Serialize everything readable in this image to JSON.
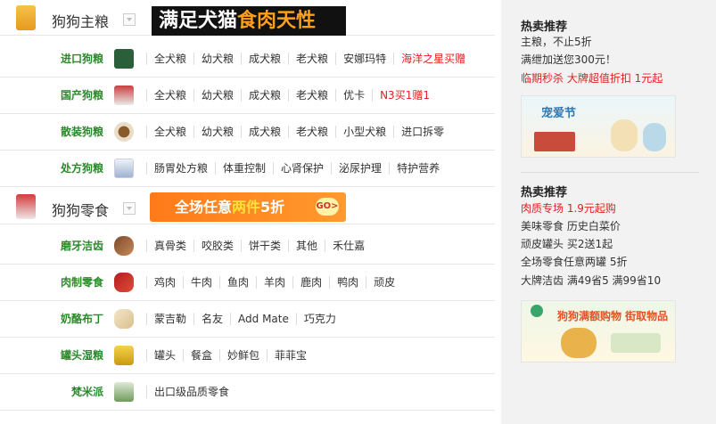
{
  "sections": [
    {
      "title": "狗狗主粮",
      "banner": {
        "white": "满足犬猫",
        "orange": "食肉天性"
      },
      "rows": [
        {
          "category": "进口狗粮",
          "links": [
            "全犬粮",
            "幼犬粮",
            "成犬粮",
            "老犬粮",
            "安娜玛特"
          ],
          "hot": "海洋之星买赠"
        },
        {
          "category": "国产狗粮",
          "links": [
            "全犬粮",
            "幼犬粮",
            "成犬粮",
            "老犬粮",
            "优卡"
          ],
          "hot": "N3买1赠1"
        },
        {
          "category": "散装狗粮",
          "links": [
            "全犬粮",
            "幼犬粮",
            "成犬粮",
            "老犬粮",
            "小型犬粮",
            "进口拆零"
          ],
          "hot": ""
        },
        {
          "category": "处方狗粮",
          "links": [
            "肠胃处方粮",
            "体重控制",
            "心肾保护",
            "泌尿护理",
            "特护营养"
          ],
          "hot": ""
        }
      ]
    },
    {
      "title": "狗狗零食",
      "banner": {
        "white": "全场任意",
        "yellow": "两件",
        "white2": "5折",
        "go": "GO>"
      },
      "rows": [
        {
          "category": "磨牙洁齿",
          "links": [
            "真骨类",
            "咬胶类",
            "饼干类",
            "其他",
            "禾仕嘉"
          ],
          "hot": ""
        },
        {
          "category": "肉制零食",
          "links": [
            "鸡肉",
            "牛肉",
            "鱼肉",
            "羊肉",
            "鹿肉",
            "鸭肉",
            "顽皮"
          ],
          "hot": ""
        },
        {
          "category": "奶酪布丁",
          "links": [
            "蒙吉勒",
            "名友",
            "Add Mate",
            "巧克力"
          ],
          "hot": ""
        },
        {
          "category": "罐头湿粮",
          "links": [
            "罐头",
            "餐盒",
            "妙鲜包",
            "菲菲宝"
          ],
          "hot": ""
        },
        {
          "category": "梵米派",
          "links": [
            "出口级品质零食"
          ],
          "hot": ""
        }
      ]
    }
  ],
  "right": {
    "block1": {
      "title": "热卖推荐",
      "lines": [
        "主粮，不止5折",
        "满绁加送您300元！"
      ],
      "red": "临期秒杀 大牌超值折扣 1元起",
      "ad_text": "宠爱节"
    },
    "block2": {
      "title": "热卖推荐",
      "red": "肉质专场 1.9元起购",
      "lines": [
        "美味零食 历史白菜价",
        "顽皮罐头 买2送1起",
        "全场零食任意两罐 5折",
        "大牌洁齿 满49省5 满99省10"
      ],
      "ad_text": "狗狗满额购物 街取物品"
    }
  },
  "colors": {
    "category_green": "#2a8a2a",
    "hot_red": "#e02020",
    "banner_orange": "#ff9f1a"
  }
}
